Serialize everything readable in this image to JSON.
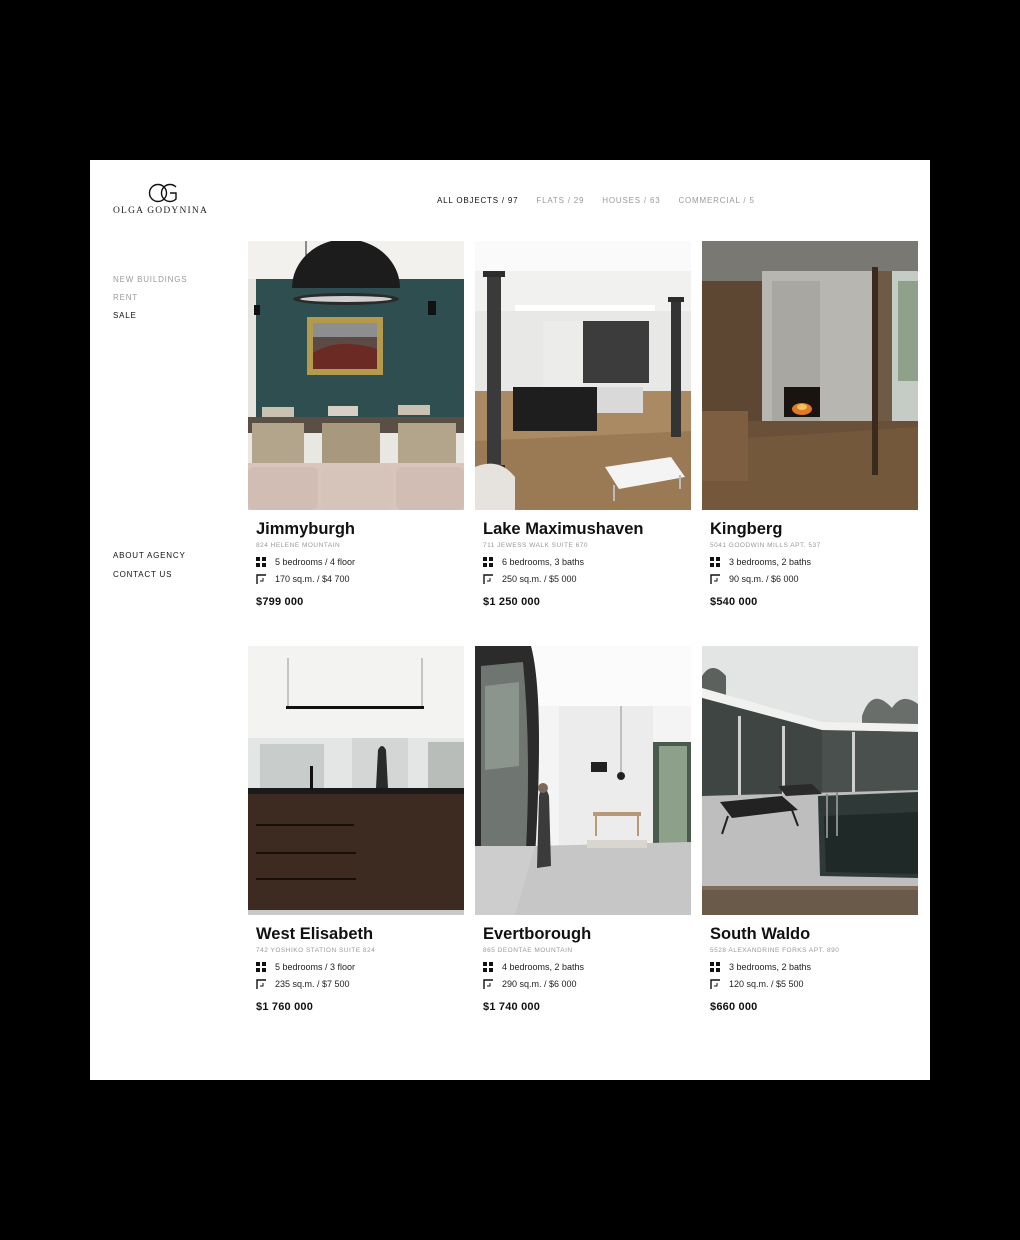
{
  "brand": {
    "name": "OLGA GODYNINA"
  },
  "filters": [
    {
      "label": "ALL OBJECTS / 97",
      "active": true
    },
    {
      "label": "FLATS / 29",
      "active": false
    },
    {
      "label": "HOUSES / 63",
      "active": false
    },
    {
      "label": "COMMERCIAL / 5",
      "active": false
    }
  ],
  "sidebar": {
    "categories": [
      {
        "label": "NEW BUILDINGS",
        "active": false
      },
      {
        "label": "RENT",
        "active": false
      },
      {
        "label": "SALE",
        "active": true
      }
    ],
    "links": [
      {
        "label": "ABOUT AGENCY"
      },
      {
        "label": "CONTACT US"
      }
    ]
  },
  "listings": [
    {
      "title": "Jimmyburgh",
      "address": "824 HELENE MOUNTAIN",
      "rooms": "5 bedrooms / 4 floor",
      "area": "170 sq.m. / $4 700",
      "price": "$799 000"
    },
    {
      "title": "Lake Maximushaven",
      "address": "711 JEWESS WALK SUITE 670",
      "rooms": "6 bedrooms, 3 baths",
      "area": "250 sq.m. / $5 000",
      "price": "$1 250 000"
    },
    {
      "title": "Kingberg",
      "address": "5041 GOODWIN MILLS APT. 537",
      "rooms": "3 bedrooms, 2 baths",
      "area": "90 sq.m. / $6 000",
      "price": "$540 000"
    },
    {
      "title": "West Elisabeth",
      "address": "742 YOSHIKO STATION SUITE 824",
      "rooms": "5 bedrooms / 3 floor",
      "area": "235 sq.m. / $7 500",
      "price": "$1 760 000"
    },
    {
      "title": "Evertborough",
      "address": "865 DEONTAE MOUNTAIN",
      "rooms": "4 bedrooms, 2 baths",
      "area": "290 sq.m. / $6 000",
      "price": "$1 740 000"
    },
    {
      "title": "South Waldo",
      "address": "5528 ALEXANDRINE FORKS APT. 890",
      "rooms": "3 bedrooms, 2 baths",
      "area": "120 sq.m. / $5 500",
      "price": "$660 000"
    }
  ]
}
